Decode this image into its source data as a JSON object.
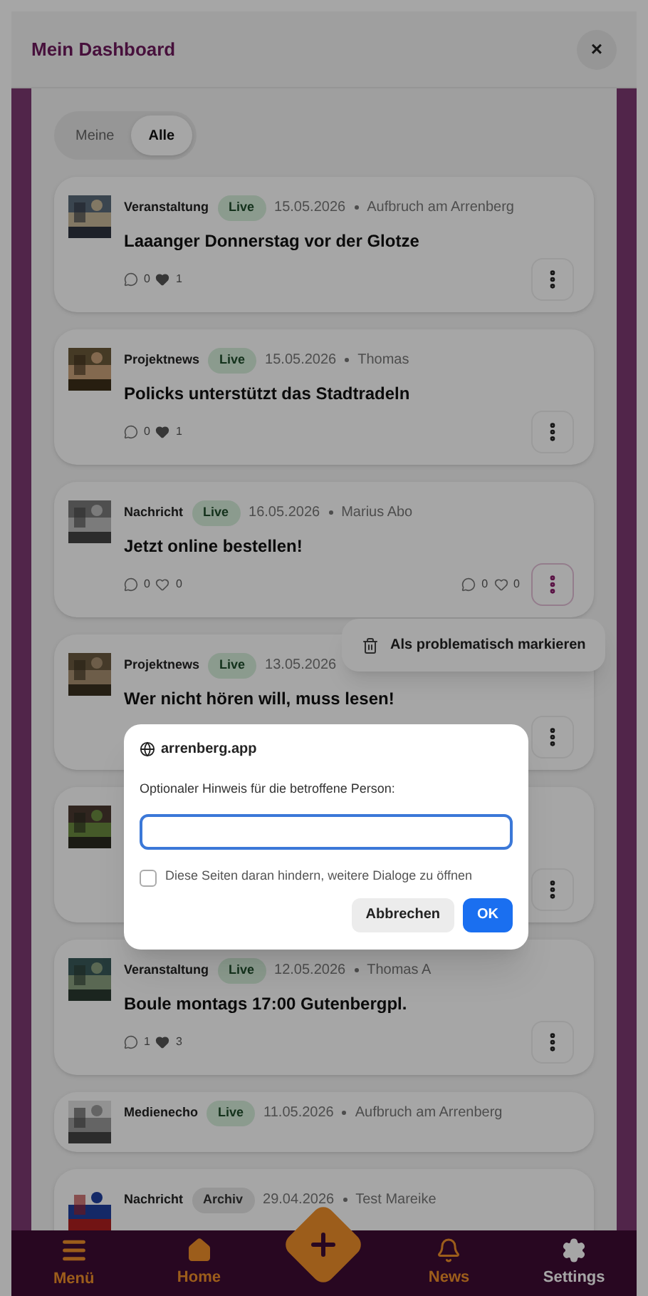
{
  "header": {
    "title": "Mein Dashboard",
    "close": "×"
  },
  "filter_tabs": [
    {
      "label": "Meine",
      "selected": false
    },
    {
      "label": "Alle",
      "selected": true
    }
  ],
  "posts": [
    {
      "kind": "full",
      "category": "Veranstaltung",
      "status": "Live",
      "archived": false,
      "date": "15.05.2026",
      "author": "Aufbruch am Arrenberg",
      "title": "Laaanger Donnerstag vor der Glotze",
      "comments": "0",
      "likes": "1",
      "liked": true
    },
    {
      "kind": "full",
      "category": "Projektnews",
      "status": "Live",
      "archived": false,
      "date": "15.05.2026",
      "author": "Thomas",
      "title": "Policks unterstützt das Stadtradeln",
      "comments": "0",
      "likes": "1",
      "liked": true
    },
    {
      "kind": "full",
      "category": "Nachricht",
      "status": "Live",
      "archived": false,
      "date": "16.05.2026",
      "author": "Marius Abo",
      "title": "Jetzt online bestellen!",
      "comments": "0",
      "likes": "0",
      "liked": false,
      "extra_comments": "0",
      "extra_likes": "0",
      "menu_open": true
    },
    {
      "kind": "full",
      "category": "Projektnews",
      "status": "Live",
      "archived": false,
      "date": "13.05.2026",
      "title": "Wer nicht hören will, muss lesen!"
    },
    {
      "kind": "full"
    },
    {
      "kind": "full",
      "category": "Veranstaltung",
      "status": "Live",
      "archived": false,
      "date": "12.05.2026",
      "author": "Thomas A",
      "title": "Boule montags 17:00 Gutenbergpl.",
      "comments": "1",
      "likes": "3",
      "liked": true
    },
    {
      "kind": "compact",
      "category": "Medienecho",
      "status": "Live",
      "archived": false,
      "date": "11.05.2026",
      "author": "Aufbruch am Arrenberg"
    },
    {
      "kind": "full",
      "category": "Nachricht",
      "status": "Archiv",
      "archived": true,
      "date": "29.04.2026",
      "author": "Test Mareike"
    }
  ],
  "context_menu": {
    "item": "Als problematisch markieren"
  },
  "dialog": {
    "origin": "arrenberg.app",
    "message": "Optionaler Hinweis für die betroffene Person:",
    "checkbox": {
      "label": "Diese Seiten daran hindern, weitere Dialoge zu öffnen",
      "checked": false
    },
    "buttons": [
      {
        "label": "Abbrechen",
        "kind": "secondary"
      },
      {
        "label": "OK",
        "kind": "primary"
      }
    ]
  },
  "nav": [
    {
      "kind": "tab",
      "label": "Menü",
      "selected": false
    },
    {
      "kind": "tab",
      "label": "Home",
      "selected": false
    },
    {
      "kind": "fab"
    },
    {
      "kind": "tab",
      "label": "News",
      "selected": false
    },
    {
      "kind": "tab",
      "label": "Settings",
      "selected": true
    }
  ]
}
